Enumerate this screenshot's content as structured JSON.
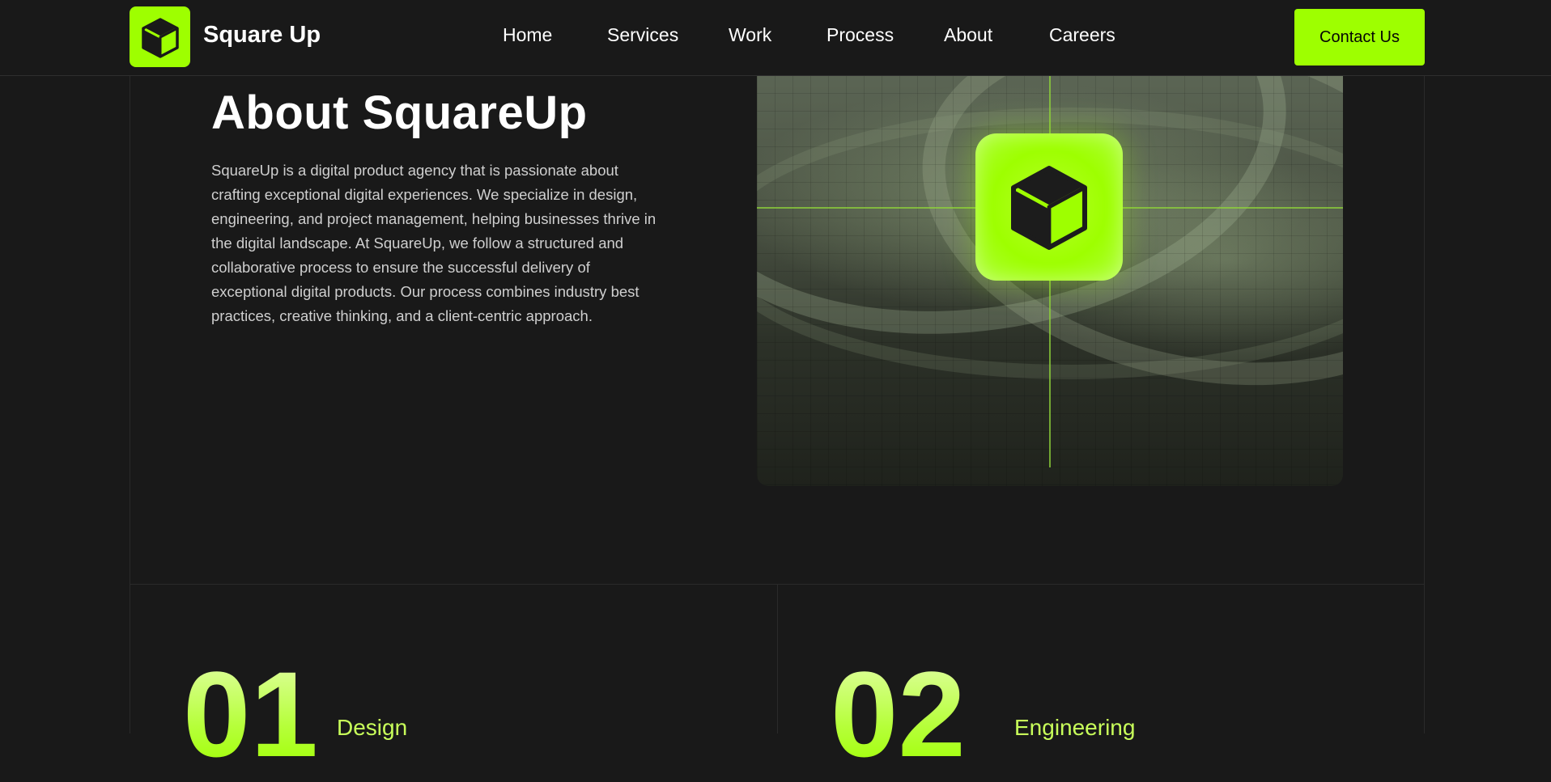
{
  "header": {
    "brand": "Square Up",
    "logo_icon": "cube-icon",
    "nav": [
      "Home",
      "Services",
      "Work",
      "Process",
      "About",
      "Careers"
    ],
    "cta": "Contact Us"
  },
  "about": {
    "title": "About SquareUp",
    "body": "SquareUp is a digital product agency that is passionate about crafting exceptional digital experiences. We specialize in design, engineering, and project management, helping businesses thrive in the digital landscape. At SquareUp, we follow a structured and collaborative process to ensure the successful delivery of exceptional digital products. Our process combines industry best practices, creative thinking, and a client-centric approach."
  },
  "steps": [
    {
      "number": "01",
      "label": "Design"
    },
    {
      "number": "02",
      "label": "Engineering"
    }
  ],
  "colors": {
    "accent": "#9EFF00",
    "background": "#191919",
    "border": "#2a2a2a"
  }
}
